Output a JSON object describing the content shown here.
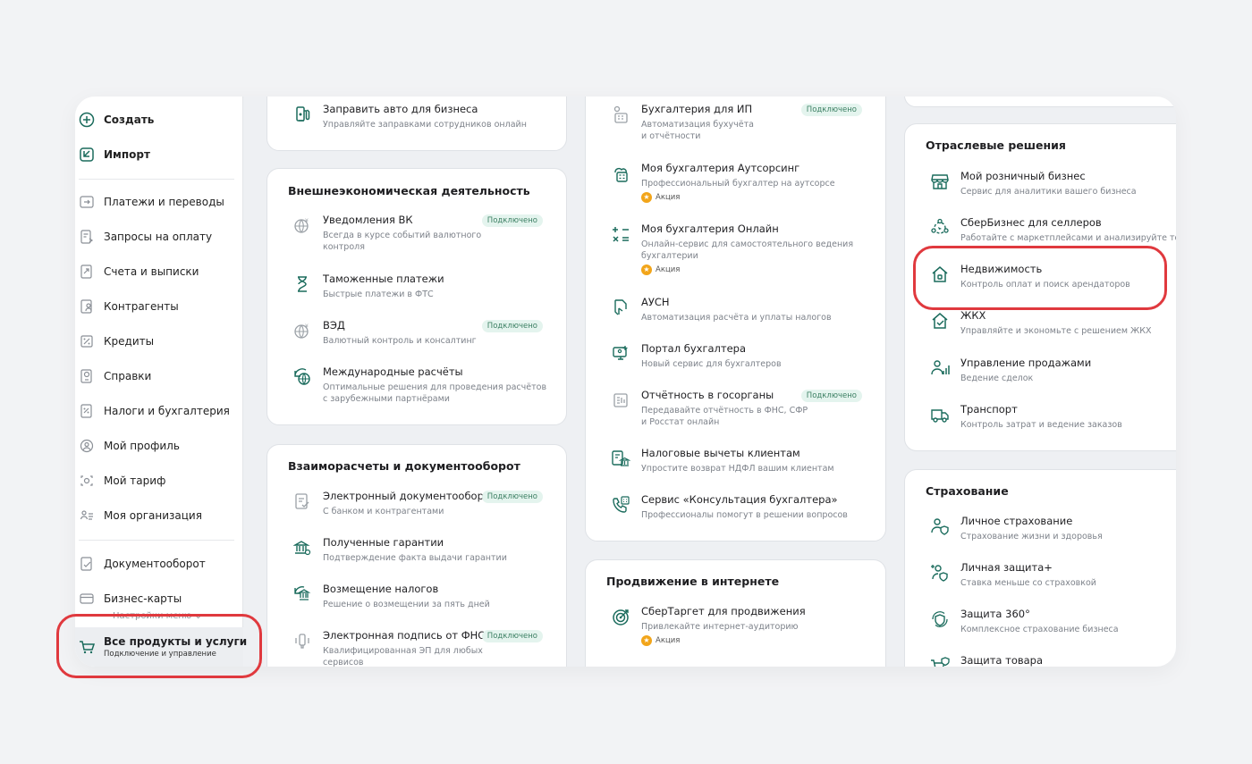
{
  "sidebar": {
    "create": "Создать",
    "import": "Импорт",
    "items": [
      {
        "label": "Платежи и переводы"
      },
      {
        "label": "Запросы на оплату"
      },
      {
        "label": "Счета и выписки"
      },
      {
        "label": "Контрагенты"
      },
      {
        "label": "Кредиты"
      },
      {
        "label": "Справки"
      },
      {
        "label": "Налоги и бухгалтерия"
      },
      {
        "label": "Мой профиль"
      },
      {
        "label": "Мой тариф"
      },
      {
        "label": "Моя организация"
      }
    ],
    "items2": [
      {
        "label": "Документооборот"
      },
      {
        "label": "Бизнес-карты"
      }
    ],
    "settings": "Настройки меню",
    "all_products": {
      "title": "Все продукты и услуги",
      "subtitle": "Подключение и управление"
    }
  },
  "col1": {
    "top": {
      "title": "Заправить авто для бизнеса",
      "desc": "Управляйте заправками сотрудников онлайн"
    },
    "ved": {
      "title": "Внешнеэкономическая деятельность",
      "items": [
        {
          "title": "Уведомления ВК",
          "desc1": "Всегда в курсе событий валютного",
          "desc2": "контроля",
          "badge": "Подключено"
        },
        {
          "title": "Таможенные платежи",
          "desc1": "Быстрые платежи в ФТС"
        },
        {
          "title": "ВЭД",
          "desc1": "Валютный контроль и консалтинг",
          "badge": "Подключено"
        },
        {
          "title": "Международные расчёты",
          "desc1": "Оптимальные решения для проведения расчётов",
          "desc2": "с зарубежными партнёрами"
        }
      ]
    },
    "docs": {
      "title": "Взаиморасчеты и документооборот",
      "items": [
        {
          "title": "Электронный документооборот",
          "desc1": "С банком и контрагентами",
          "badge": "Подключено"
        },
        {
          "title": "Полученные гарантии",
          "desc1": "Подтверждение факта выдачи гарантии"
        },
        {
          "title": "Возмещение налогов",
          "desc1": "Решение о возмещении за пять дней"
        },
        {
          "title": "Электронная подпись от ФНС",
          "desc1": "Квалифицированная ЭП для любых",
          "desc2": "сервисов",
          "badge": "Подключено"
        }
      ]
    }
  },
  "col2": {
    "acc": {
      "items": [
        {
          "title": "Бухгалтерия для ИП",
          "desc1": "Автоматизация бухучёта",
          "desc2": "и отчётности",
          "badge": "Подключено"
        },
        {
          "title": "Моя бухгалтерия Аутсорсинг",
          "desc1": "Профессиональный бухгалтер на аутсорсе",
          "promo": "Акция"
        },
        {
          "title": "Моя бухгалтерия Онлайн",
          "desc1": "Онлайн-сервис для самостоятельного ведения",
          "desc2": "бухгалтерии",
          "promo": "Акция"
        },
        {
          "title": "АУСН",
          "desc1": "Автоматизация расчёта и уплаты налогов"
        },
        {
          "title": "Портал бухгалтера",
          "desc1": "Новый сервис для бухгалтеров"
        },
        {
          "title": "Отчётность в госорганы",
          "desc1": "Передавайте отчётность в ФНС, СФР",
          "desc2": "и Росстат онлайн",
          "badge": "Подключено"
        },
        {
          "title": "Налоговые вычеты клиентам",
          "desc1": "Упростите возврат НДФЛ вашим клиентам"
        },
        {
          "title": "Сервис «Консультация бухгалтера»",
          "desc1": "Профессионалы помогут в решении вопросов"
        }
      ]
    },
    "promo_card": {
      "title": "Продвижение в интернете",
      "items": [
        {
          "title": "СберТаргет для продвижения",
          "desc1": "Привлекайте интернет-аудиторию",
          "promo": "Акция"
        }
      ]
    }
  },
  "col3": {
    "industry": {
      "title": "Отраслевые решения",
      "items": [
        {
          "title": "Мой розничный бизнес",
          "desc1": "Сервис для аналитики вашего бизнеса"
        },
        {
          "title": "СберБизнес для селлеров",
          "desc1": "Работайте с маркетплейсами и анализируйте товары"
        },
        {
          "title": "Недвижимость",
          "desc1": "Контроль оплат и поиск арендаторов"
        },
        {
          "title": "ЖКХ",
          "desc1": "Управляйте и экономьте с решением ЖКХ"
        },
        {
          "title": "Управление продажами",
          "desc1": "Ведение сделок"
        },
        {
          "title": "Транспорт",
          "desc1": "Контроль затрат и ведение заказов"
        }
      ]
    },
    "insurance": {
      "title": "Страхование",
      "items": [
        {
          "title": "Личное страхование",
          "desc1": "Страхование жизни и здоровья"
        },
        {
          "title": "Личная защита+",
          "desc1": "Ставка меньше со страховкой"
        },
        {
          "title": "Защита 360°",
          "desc1": "Комплексное страхование бизнеса"
        },
        {
          "title": "Защита товара",
          "desc1": ""
        }
      ]
    }
  },
  "colors": {
    "accent": "#1a6b5c",
    "highlight": "#e0393e",
    "badge_bg": "#e4f4ee",
    "promo_star": "#f2a51a"
  }
}
